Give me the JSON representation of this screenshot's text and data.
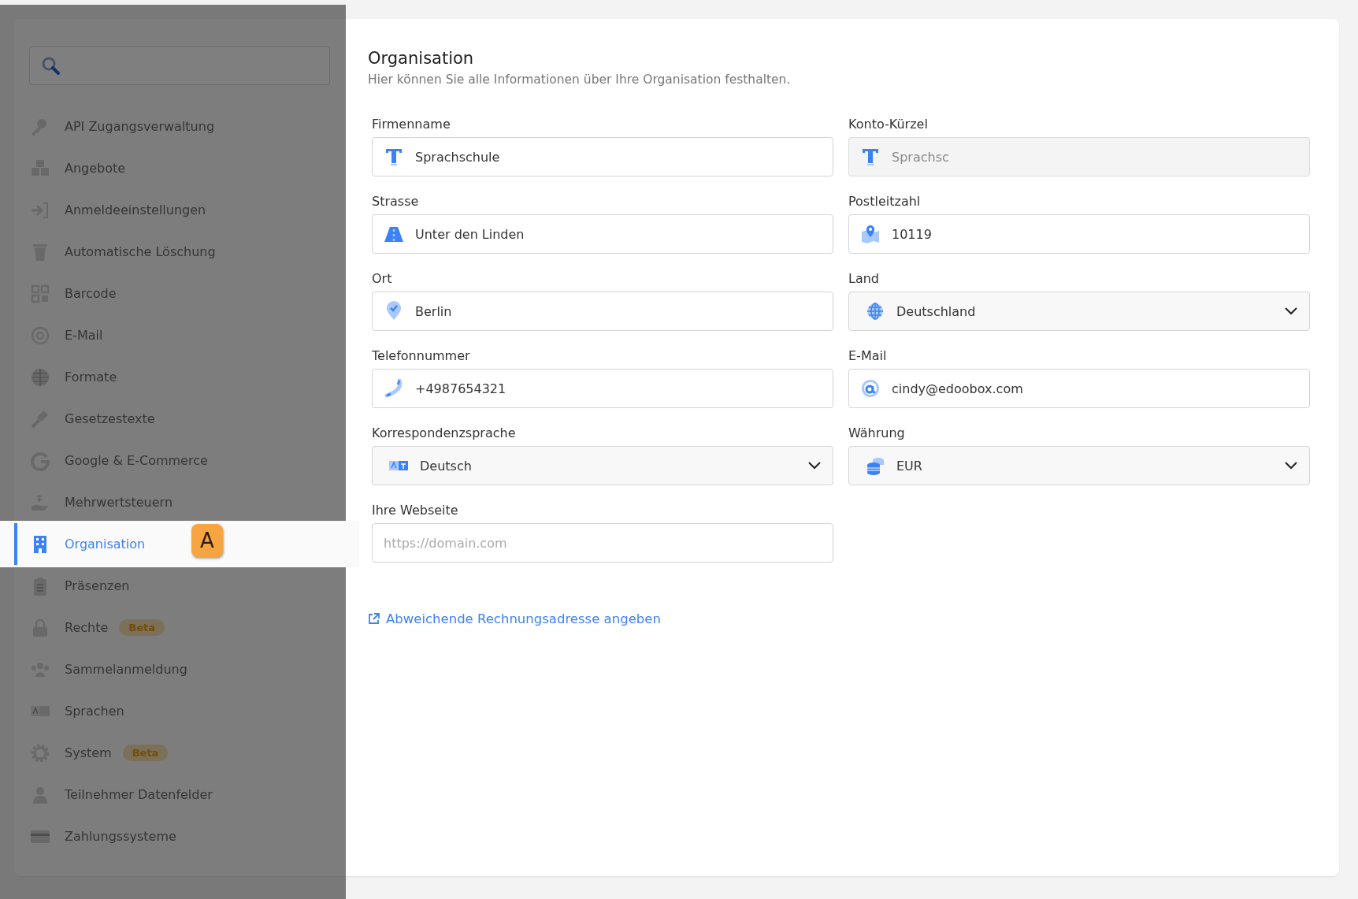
{
  "sidebar": {
    "items": [
      {
        "label": "API Zugangsverwaltung",
        "selected": false
      },
      {
        "label": "Angebote",
        "selected": false
      },
      {
        "label": "Anmeldeeinstellungen",
        "selected": false
      },
      {
        "label": "Automatische Löschung",
        "selected": false
      },
      {
        "label": "Barcode",
        "selected": false
      },
      {
        "label": "E-Mail",
        "selected": false
      },
      {
        "label": "Formate",
        "selected": false
      },
      {
        "label": "Gesetzestexte",
        "selected": false
      },
      {
        "label": "Google & E-Commerce",
        "selected": false
      },
      {
        "label": "Mehrwertsteuern",
        "selected": false
      },
      {
        "label": "Organisation",
        "selected": true,
        "marker": "A"
      },
      {
        "label": "Präsenzen",
        "selected": false
      },
      {
        "label": "Rechte",
        "selected": false,
        "badge": "Beta"
      },
      {
        "label": "Sammelanmeldung",
        "selected": false
      },
      {
        "label": "Sprachen",
        "selected": false
      },
      {
        "label": "System",
        "selected": false,
        "badge": "Beta"
      },
      {
        "label": "Teilnehmer Datenfelder",
        "selected": false
      },
      {
        "label": "Zahlungssysteme",
        "selected": false
      }
    ]
  },
  "main": {
    "title": "Organisation",
    "subtitle": "Hier können Sie alle Informationen über Ihre Organisation festhalten.",
    "fields": [
      {
        "label": "Firmenname",
        "kind": "text",
        "value": "Sprachschule",
        "disabled": false
      },
      {
        "label": "Konto-Kürzel",
        "kind": "text",
        "value": "Sprachsc",
        "disabled": true
      },
      {
        "label": "Strasse",
        "kind": "text",
        "value": "Unter den Linden",
        "disabled": false
      },
      {
        "label": "Postleitzahl",
        "kind": "text",
        "value": "10119",
        "disabled": false
      },
      {
        "label": "Ort",
        "kind": "text",
        "value": "Berlin",
        "disabled": false
      },
      {
        "label": "Land",
        "kind": "select",
        "value": "Deutschland",
        "disabled": false
      },
      {
        "label": "Telefonnummer",
        "kind": "text",
        "value": "+4987654321",
        "disabled": false
      },
      {
        "label": "E-Mail",
        "kind": "text",
        "value": "cindy@edoobox.com",
        "disabled": false
      },
      {
        "label": "Korrespondenzsprache",
        "kind": "select",
        "value": "Deutsch",
        "disabled": false
      },
      {
        "label": "Währung",
        "kind": "select",
        "value": "EUR",
        "disabled": false
      },
      {
        "label": "Ihre Webseite",
        "kind": "text",
        "placeholder": "https://domain.com",
        "disabled": false
      }
    ],
    "link": "Abweichende Rechnungsadresse angeben"
  }
}
